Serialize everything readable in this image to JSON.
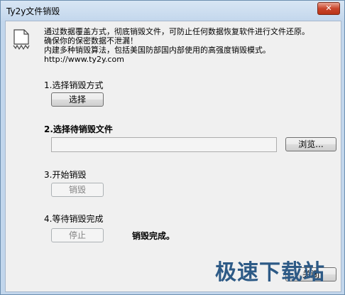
{
  "window": {
    "title": "Ty2y文件销毁",
    "close_label": "✕"
  },
  "description": {
    "line1": "通过数据覆盖方式，彻底销毁文件，可防止任何数据恢复软件进行文件还原。",
    "line2": "确保你的保密数据不泄漏！",
    "line3": "内建多种销毁算法，包括美国防部国内部使用的高强度销毁模式。",
    "line4": "http://www.ty2y.com"
  },
  "steps": {
    "step1_label": "1.选择销毁方式",
    "step1_button": "选择",
    "step2_label": "2.选择待销毁文件",
    "step2_input_value": "",
    "step2_button": "浏览...",
    "step3_label": "3.开始销毁",
    "step3_button": "销毁",
    "step4_label": "4.等待销毁完成",
    "step4_button": "停止",
    "status_text": "销毁完成。"
  },
  "watermark": "极速下载站",
  "footer": {
    "close_button": "关闭"
  }
}
